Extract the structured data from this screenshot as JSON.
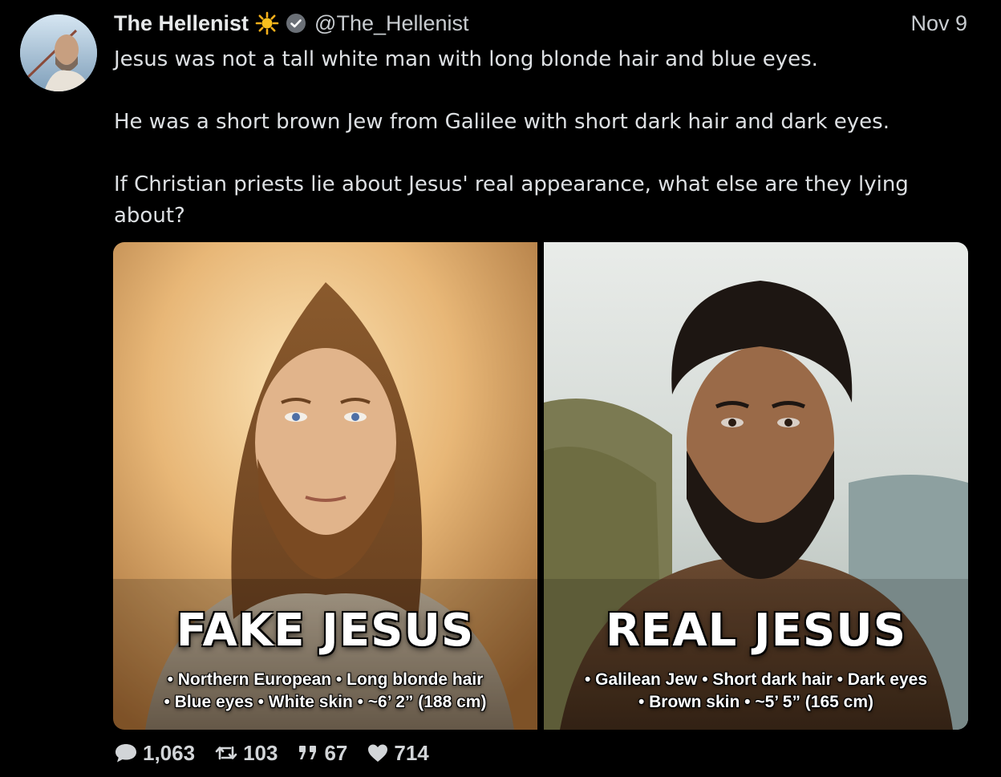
{
  "post": {
    "author_name": "The Hellenist",
    "handle": "@The_Hellenist",
    "date": "Nov 9",
    "paragraphs": [
      "Jesus was not a tall white man with long blonde hair and blue eyes.",
      "He was a short brown Jew from Galilee with short dark hair and dark eyes.",
      "If Christian priests lie about Jesus' real appearance, what else are they lying about?"
    ]
  },
  "media": {
    "left": {
      "title": "FAKE JESUS",
      "line1": "• Northern European • Long blonde hair",
      "line2": "• Blue eyes • White skin • ~6’ 2” (188 cm)"
    },
    "right": {
      "title": "REAL JESUS",
      "line1": "• Galilean Jew • Short dark hair • Dark eyes",
      "line2": "• Brown skin • ~5’ 5” (165 cm)"
    }
  },
  "actions": {
    "replies": "1,063",
    "reposts": "103",
    "quotes": "67",
    "likes": "714"
  },
  "icons": [
    "sun-icon",
    "verified-icon",
    "reply-icon",
    "repost-icon",
    "quote-icon",
    "like-icon"
  ],
  "colors": {
    "background": "#000000",
    "text": "#e7e9ea",
    "verified": "#6b7077"
  }
}
